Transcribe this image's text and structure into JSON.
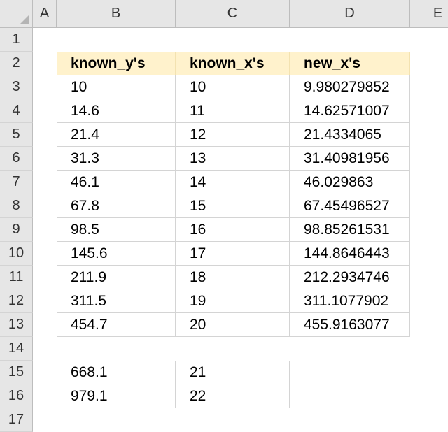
{
  "columns": [
    "A",
    "B",
    "C",
    "D",
    "E"
  ],
  "rows": [
    "1",
    "2",
    "3",
    "4",
    "5",
    "6",
    "7",
    "8",
    "9",
    "10",
    "11",
    "12",
    "13",
    "14",
    "15",
    "16",
    "17"
  ],
  "table": {
    "headers": [
      "known_y's",
      "known_x's",
      "new_x's"
    ],
    "rows": [
      [
        "10",
        "10",
        "9.980279852"
      ],
      [
        "14.6",
        "11",
        "14.62571007"
      ],
      [
        "21.4",
        "12",
        "21.4334065"
      ],
      [
        "31.3",
        "13",
        "31.40981956"
      ],
      [
        "46.1",
        "14",
        "46.029863"
      ],
      [
        "67.8",
        "15",
        "67.45496527"
      ],
      [
        "98.5",
        "16",
        "98.85261531"
      ],
      [
        "145.6",
        "17",
        "144.8646443"
      ],
      [
        "211.9",
        "18",
        "212.2934746"
      ],
      [
        "311.5",
        "19",
        "311.1077902"
      ],
      [
        "454.7",
        "20",
        "455.9163077"
      ]
    ]
  },
  "forecast": {
    "rows": [
      [
        "668.1",
        "21"
      ],
      [
        "979.1",
        "22"
      ]
    ]
  },
  "colors": {
    "header_fill": "#fff2cc",
    "grid": "#d4d4d4",
    "heading_bg": "#e6e6e6"
  }
}
